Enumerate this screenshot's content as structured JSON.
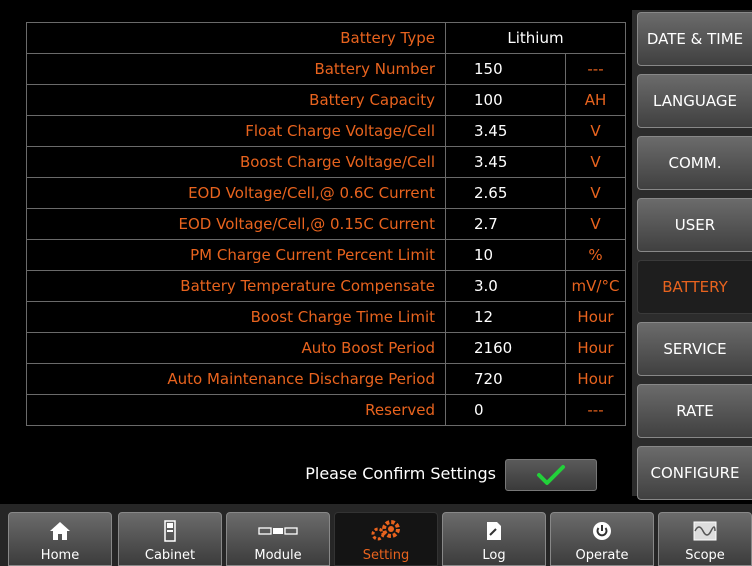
{
  "settings": [
    {
      "label": "Battery Type",
      "value": "Lithium",
      "unit": ""
    },
    {
      "label": "Battery Number",
      "value": "150",
      "unit": "---"
    },
    {
      "label": "Battery Capacity",
      "value": "100",
      "unit": "AH"
    },
    {
      "label": "Float Charge Voltage/Cell",
      "value": "3.45",
      "unit": "V"
    },
    {
      "label": "Boost Charge Voltage/Cell",
      "value": "3.45",
      "unit": "V"
    },
    {
      "label": "EOD Voltage/Cell,@ 0.6C Current",
      "value": "2.65",
      "unit": "V"
    },
    {
      "label": "EOD Voltage/Cell,@ 0.15C Current",
      "value": "2.7",
      "unit": "V"
    },
    {
      "label": "PM Charge Current Percent Limit",
      "value": "10",
      "unit": "%"
    },
    {
      "label": "Battery Temperature Compensate",
      "value": "3.0",
      "unit": "mV/°C"
    },
    {
      "label": "Boost Charge Time Limit",
      "value": "12",
      "unit": "Hour"
    },
    {
      "label": "Auto Boost Period",
      "value": "2160",
      "unit": "Hour"
    },
    {
      "label": "Auto Maintenance Discharge Period",
      "value": "720",
      "unit": "Hour"
    },
    {
      "label": "Reserved",
      "value": "0",
      "unit": "---"
    }
  ],
  "confirm": {
    "text": "Please Confirm Settings"
  },
  "side_menu": [
    "DATE & TIME",
    "LANGUAGE",
    "COMM.",
    "USER",
    "BATTERY",
    "SERVICE",
    "RATE",
    "CONFIGURE"
  ],
  "side_active": "BATTERY",
  "tabs": [
    {
      "label": "Home",
      "icon": "home-icon"
    },
    {
      "label": "Cabinet",
      "icon": "cabinet-icon"
    },
    {
      "label": "Module",
      "icon": "module-icon"
    },
    {
      "label": "Setting",
      "icon": "gear-icon"
    },
    {
      "label": "Log",
      "icon": "log-icon"
    },
    {
      "label": "Operate",
      "icon": "power-icon"
    },
    {
      "label": "Scope",
      "icon": "scope-icon"
    }
  ],
  "tab_active": "Setting",
  "colors": {
    "accent": "#e8631e",
    "check": "#22d13a"
  }
}
